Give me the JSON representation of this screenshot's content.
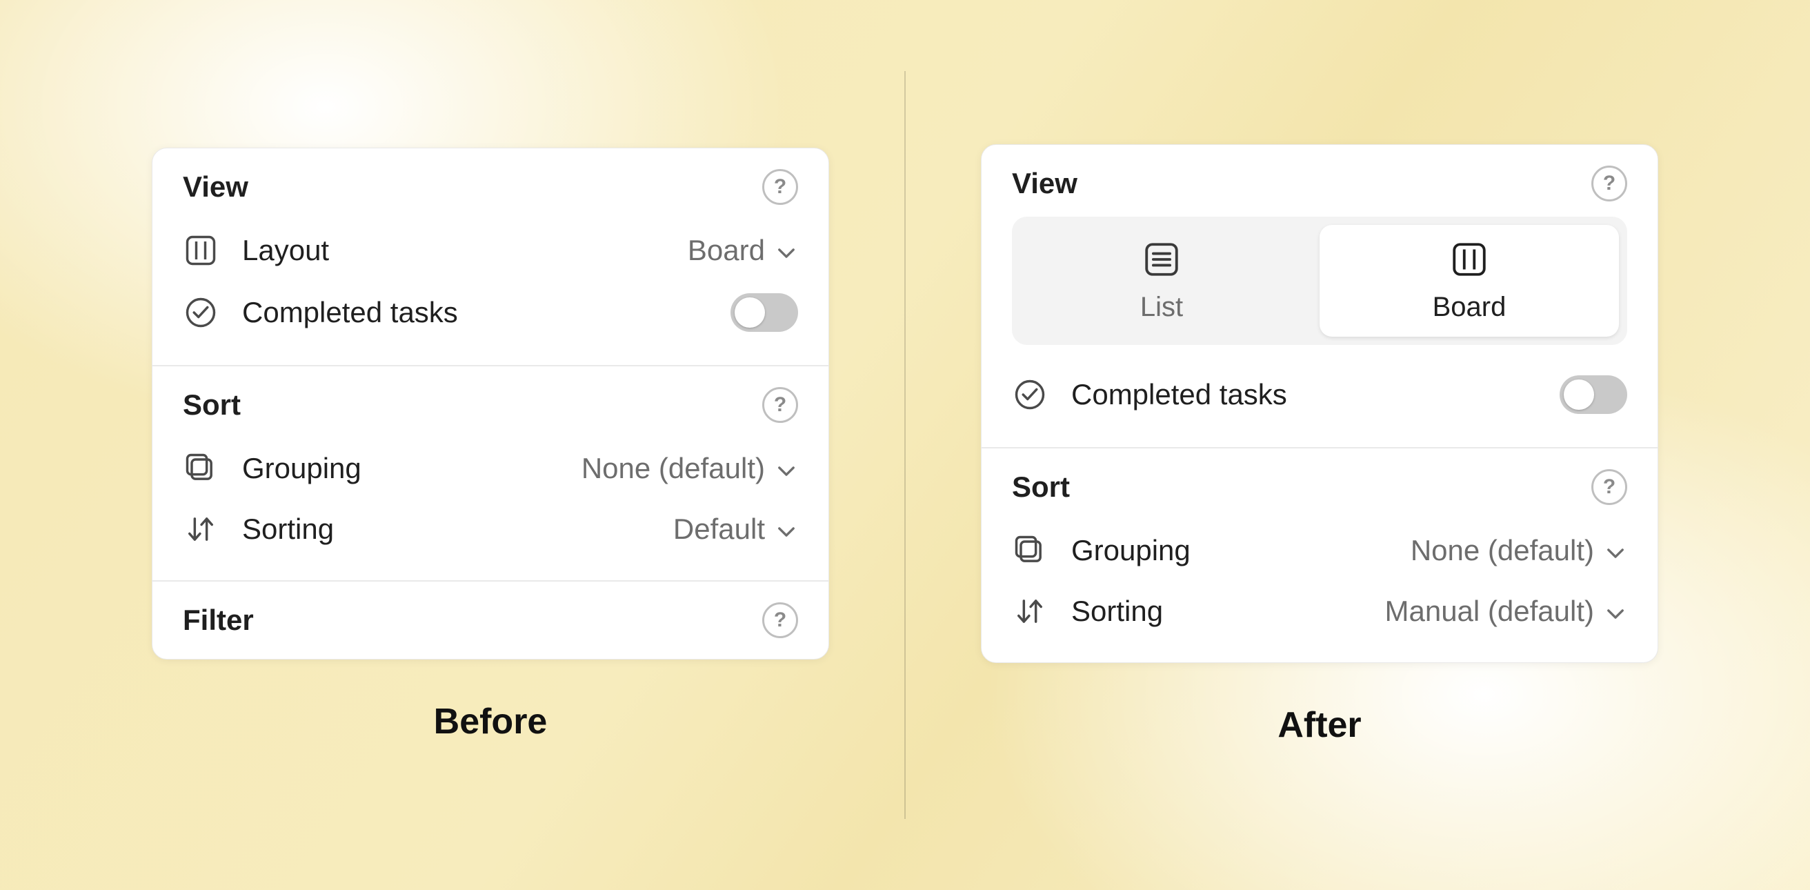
{
  "captions": {
    "before": "Before",
    "after": "After"
  },
  "before": {
    "view": {
      "title": "View",
      "layout_label": "Layout",
      "layout_value": "Board",
      "completed_label": "Completed tasks",
      "completed_on": false
    },
    "sort": {
      "title": "Sort",
      "grouping_label": "Grouping",
      "grouping_value": "None (default)",
      "sorting_label": "Sorting",
      "sorting_value": "Default"
    },
    "filter": {
      "title": "Filter"
    }
  },
  "after": {
    "view": {
      "title": "View",
      "option_list": "List",
      "option_board": "Board",
      "selected": "Board",
      "completed_label": "Completed tasks",
      "completed_on": false
    },
    "sort": {
      "title": "Sort",
      "grouping_label": "Grouping",
      "grouping_value": "None (default)",
      "sorting_label": "Sorting",
      "sorting_value": "Manual (default)"
    }
  }
}
